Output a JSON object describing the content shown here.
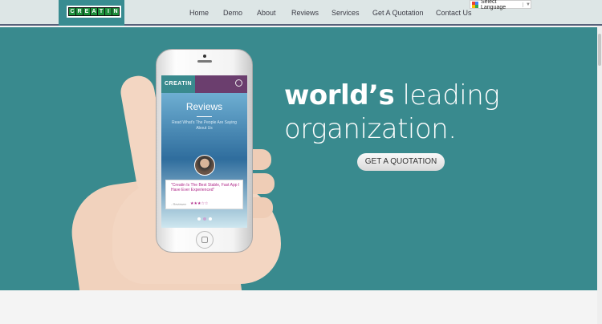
{
  "header": {
    "logo_letters": [
      "C",
      "R",
      "E",
      "A",
      "T",
      "I",
      "N"
    ],
    "nav": [
      {
        "label": "Home"
      },
      {
        "label": "Demo"
      },
      {
        "label": "About"
      },
      {
        "label": "Reviews"
      },
      {
        "label": "Services"
      },
      {
        "label": "Get A Quotation"
      },
      {
        "label": "Contact Us"
      }
    ],
    "translate_label": "Select Language"
  },
  "hero": {
    "headline_bold": "world’s",
    "headline_rest": "leading",
    "headline_line2": "organization.",
    "cta_label": "GET A QUOTATION",
    "bg_color": "#398a8e"
  },
  "phone_app": {
    "brand": "CREATIN",
    "title": "Reviews",
    "subtitle": "Read What's The People Are Saying About Us",
    "quote": "\"Creatin Is The Best Stable, Fast App I Have Ever Experienced\"",
    "reviewer": "- Reviewer",
    "rating_stars": "★★★☆☆"
  }
}
